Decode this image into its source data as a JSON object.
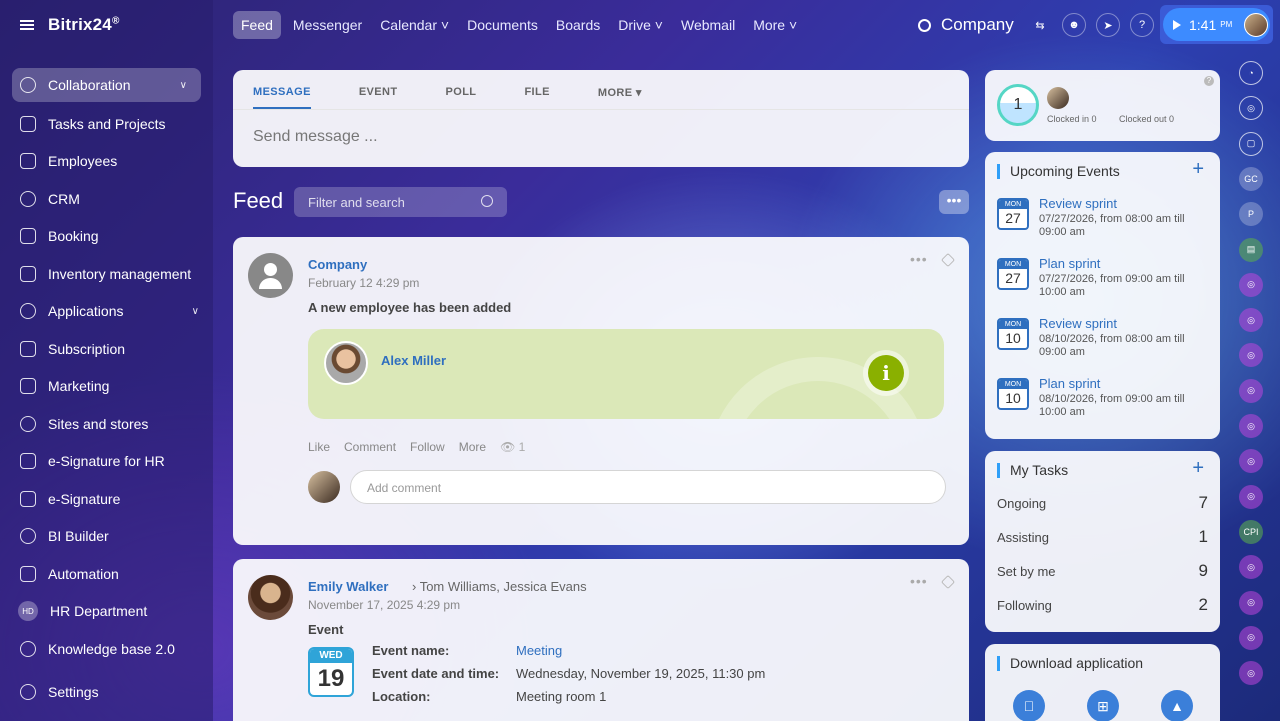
{
  "app": {
    "logo": "Bitrix24",
    "logo_mark": "®"
  },
  "sidebar": {
    "items": [
      {
        "label": "Collaboration",
        "icon": "collaboration-icon",
        "active": true,
        "chevron": true
      },
      {
        "label": "Tasks and Projects",
        "icon": "tasks-icon"
      },
      {
        "label": "Employees",
        "icon": "employees-icon"
      },
      {
        "label": "CRM",
        "icon": "crm-icon"
      },
      {
        "label": "Booking",
        "icon": "booking-icon"
      },
      {
        "label": "Inventory management",
        "icon": "inventory-icon"
      },
      {
        "label": "Applications",
        "icon": "applications-icon",
        "chevron": true
      },
      {
        "label": "Subscription",
        "icon": "subscription-icon"
      },
      {
        "label": "Marketing",
        "icon": "marketing-icon"
      },
      {
        "label": "Sites and stores",
        "icon": "cart-icon"
      },
      {
        "label": "e-Signature for HR",
        "icon": "signature-hr-icon"
      },
      {
        "label": "e-Signature",
        "icon": "signature-icon"
      },
      {
        "label": "BI Builder",
        "icon": "bi-builder-icon"
      },
      {
        "label": "Automation",
        "icon": "automation-icon"
      },
      {
        "label": "HR Department",
        "icon": "hd-badge",
        "badge": "HD"
      },
      {
        "label": "Knowledge base 2.0",
        "icon": "knowledge-base-icon"
      }
    ],
    "settings_label": "Settings"
  },
  "topbar": {
    "tabs": [
      {
        "label": "Feed",
        "active": true
      },
      {
        "label": "Messenger"
      },
      {
        "label": "Calendar ˅"
      },
      {
        "label": "Documents"
      },
      {
        "label": "Boards"
      },
      {
        "label": "Drive ˅"
      },
      {
        "label": "Webmail"
      },
      {
        "label": "More ˅"
      }
    ],
    "company": "Company",
    "time": "1:41",
    "time_suffix": "PM",
    "help": "?"
  },
  "composer": {
    "tabs": [
      "MESSAGE",
      "EVENT",
      "POLL",
      "FILE",
      "MORE ▾"
    ],
    "placeholder": "Send message ..."
  },
  "feed": {
    "title": "Feed",
    "filter_placeholder": "Filter and search",
    "more": "•••"
  },
  "post1": {
    "author": "Company",
    "date": "February 12 4:29 pm",
    "announcement": "A new employee has been added",
    "employee": "Alex Miller",
    "info": "i",
    "actions": {
      "like": "Like",
      "comment": "Comment",
      "follow": "Follow",
      "more": "More",
      "views": "👁 1"
    },
    "comment_placeholder": "Add comment",
    "dots": "•••"
  },
  "post2": {
    "author": "Emily Walker",
    "recipients": "›  Tom Williams, Jessica Evans",
    "date": "November 17, 2025 4:29 pm",
    "label": "Event",
    "cal_day": "WED",
    "cal_num": "19",
    "dots": "•••",
    "fields": [
      {
        "key": "Event name:",
        "value": "Meeting",
        "link": true
      },
      {
        "key": "Event date and time:",
        "value": "Wednesday, November 19, 2025, 11:30 pm"
      },
      {
        "key": "Location:",
        "value": "Meeting room 1"
      }
    ]
  },
  "timeman": {
    "count": "1",
    "clocked_in": "Clocked in 0",
    "clocked_out": "Clocked out 0",
    "help": "?"
  },
  "events": {
    "title": "Upcoming Events",
    "add": "+",
    "items": [
      {
        "day": "MON",
        "num": "27",
        "title": "Review sprint",
        "time": "07/27/2026, from 08:00 am till 09:00 am"
      },
      {
        "day": "MON",
        "num": "27",
        "title": "Plan sprint",
        "time": "07/27/2026, from 09:00 am till 10:00 am"
      },
      {
        "day": "MON",
        "num": "10",
        "title": "Review sprint",
        "time": "08/10/2026, from 08:00 am till 09:00 am"
      },
      {
        "day": "MON",
        "num": "10",
        "title": "Plan sprint",
        "time": "08/10/2026, from 09:00 am till 10:00 am"
      }
    ]
  },
  "tasks": {
    "title": "My Tasks",
    "add": "+",
    "rows": [
      {
        "label": "Ongoing",
        "count": "7"
      },
      {
        "label": "Assisting",
        "count": "1"
      },
      {
        "label": "Set by me",
        "count": "9"
      },
      {
        "label": "Following",
        "count": "2"
      }
    ]
  },
  "download": {
    "title": "Download application",
    "apps": [
      {
        "glyph": "",
        "icon": "apple-icon"
      },
      {
        "glyph": "⊞",
        "icon": "windows-icon"
      },
      {
        "glyph": "▲",
        "icon": "linux-icon"
      }
    ]
  },
  "rail": {
    "buttons": [
      {
        "icon": "bell-icon",
        "text": "◔",
        "style": "plain"
      },
      {
        "icon": "activity-icon",
        "text": "◎",
        "style": "plain"
      },
      {
        "icon": "chat-icon",
        "text": "▢",
        "style": "plain"
      },
      {
        "icon": "gc-avatar",
        "text": "GC",
        "style": "label"
      },
      {
        "icon": "p-avatar",
        "text": "P",
        "style": "label"
      },
      {
        "icon": "contact-card-icon",
        "text": "▤",
        "style": "green"
      },
      {
        "icon": "channel-icon",
        "text": "◎",
        "style": "pink"
      },
      {
        "icon": "channel-icon",
        "text": "◎",
        "style": "pink"
      },
      {
        "icon": "channel-icon",
        "text": "◎",
        "style": "pink"
      },
      {
        "icon": "channel-icon",
        "text": "◎",
        "style": "pink"
      },
      {
        "icon": "channel-icon",
        "text": "◎",
        "style": "pink"
      },
      {
        "icon": "channel-icon",
        "text": "◎",
        "style": "pink"
      },
      {
        "icon": "channel-icon",
        "text": "◎",
        "style": "pink"
      },
      {
        "icon": "cpi-avatar",
        "text": "CPI",
        "style": "green"
      },
      {
        "icon": "channel-icon",
        "text": "◎",
        "style": "pink"
      },
      {
        "icon": "channel-icon",
        "text": "◎",
        "style": "pink"
      },
      {
        "icon": "channel-icon",
        "text": "◎",
        "style": "pink"
      },
      {
        "icon": "channel-icon",
        "text": "◎",
        "style": "pink"
      }
    ]
  }
}
